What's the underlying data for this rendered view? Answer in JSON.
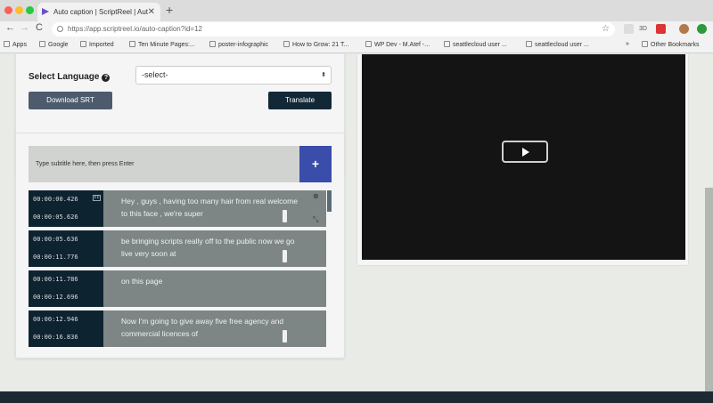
{
  "browser": {
    "tab_title": "Auto caption | ScriptReel | Aut",
    "tab_close": "✕",
    "new_tab": "+",
    "url": "https://app.scriptreel.io/auto-caption?id=12",
    "back": "←",
    "forward": "→",
    "reload": "C",
    "star": "☆",
    "extensions": [
      "3D"
    ]
  },
  "bookmarks": [
    {
      "label": "Apps"
    },
    {
      "label": "Google"
    },
    {
      "label": "Imported"
    },
    {
      "label": "Ten Minute Pages:..."
    },
    {
      "label": "poster-infographic"
    },
    {
      "label": "How to Grow: 21 T..."
    },
    {
      "label": "WP Dev - M.Atef -..."
    },
    {
      "label": "seattlecloud user ..."
    },
    {
      "label": "seattlecloud user ..."
    }
  ],
  "bookmarks_more": "»",
  "other_bookmarks": "Other Bookmarks",
  "language": {
    "label": "Select Language",
    "help": "?",
    "select_value": "-select-",
    "select_arrows": "⬍"
  },
  "buttons": {
    "download_srt": "Download SRT",
    "translate": "Translate",
    "add": "+"
  },
  "subtitle_input": {
    "placeholder": "Type subtitle here, then press Enter"
  },
  "captions": [
    {
      "start": "00:00:00.426",
      "end": "00:00:05.626",
      "text": "Hey , guys , having too many hair from real welcome to this face , we're super"
    },
    {
      "start": "00:00:05.636",
      "end": "00:00:11.776",
      "text": "be bringing scripts really off to the public now we go live very soon at"
    },
    {
      "start": "00:00:11.786",
      "end": "00:00:12.696",
      "text": "on this page"
    },
    {
      "start": "00:00:12.946",
      "end": "00:00:16.836",
      "text": "Now I'm going to give away five free agency and commercial licences of"
    }
  ],
  "caption_icons": {
    "cc": "cc",
    "settings": "⊗",
    "expand": "⤡"
  },
  "colors": {
    "primary_dark": "#132836",
    "secondary": "#4d5b6c",
    "accent_blue": "#3a4dab",
    "caption_text_bg": "#7d8685"
  }
}
